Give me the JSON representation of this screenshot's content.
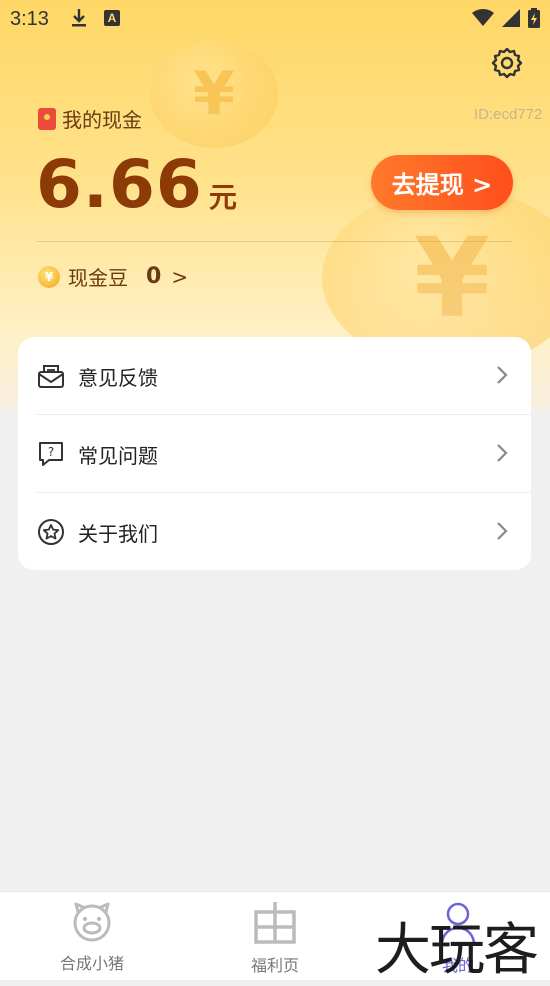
{
  "status_bar": {
    "time": "3:13",
    "icons": [
      "download-icon",
      "keyboard-a-icon",
      "wifi-icon",
      "signal-icon",
      "battery-charging-icon"
    ]
  },
  "header": {
    "settings_icon": "gear-icon",
    "cash_title": "我的现金",
    "user_id": "ID:ecd772",
    "balance_value": "6.66",
    "balance_unit": "元",
    "withdraw_button_label": "去提现 >",
    "beans_label": "现金豆",
    "beans_value": "0",
    "beans_arrow": ">"
  },
  "menu": {
    "items": [
      {
        "label": "意见反馈",
        "icon": "mail-icon"
      },
      {
        "label": "常见问题",
        "icon": "question-bubble-icon"
      },
      {
        "label": "关于我们",
        "icon": "star-circle-icon"
      }
    ]
  },
  "bottom_nav": {
    "items": [
      {
        "label": "合成小猪",
        "icon": "pig-icon",
        "active": false
      },
      {
        "label": "福利页",
        "icon": "grid-field-icon",
        "active": false
      },
      {
        "label": "我的",
        "icon": "person-icon",
        "active": true
      }
    ]
  },
  "watermark": "大玩客",
  "colors": {
    "accent_orange": "#ff5a1f",
    "amount_brown": "#8c3a06",
    "nav_active": "#6c63d9",
    "hero_yellow": "#ffd766"
  }
}
